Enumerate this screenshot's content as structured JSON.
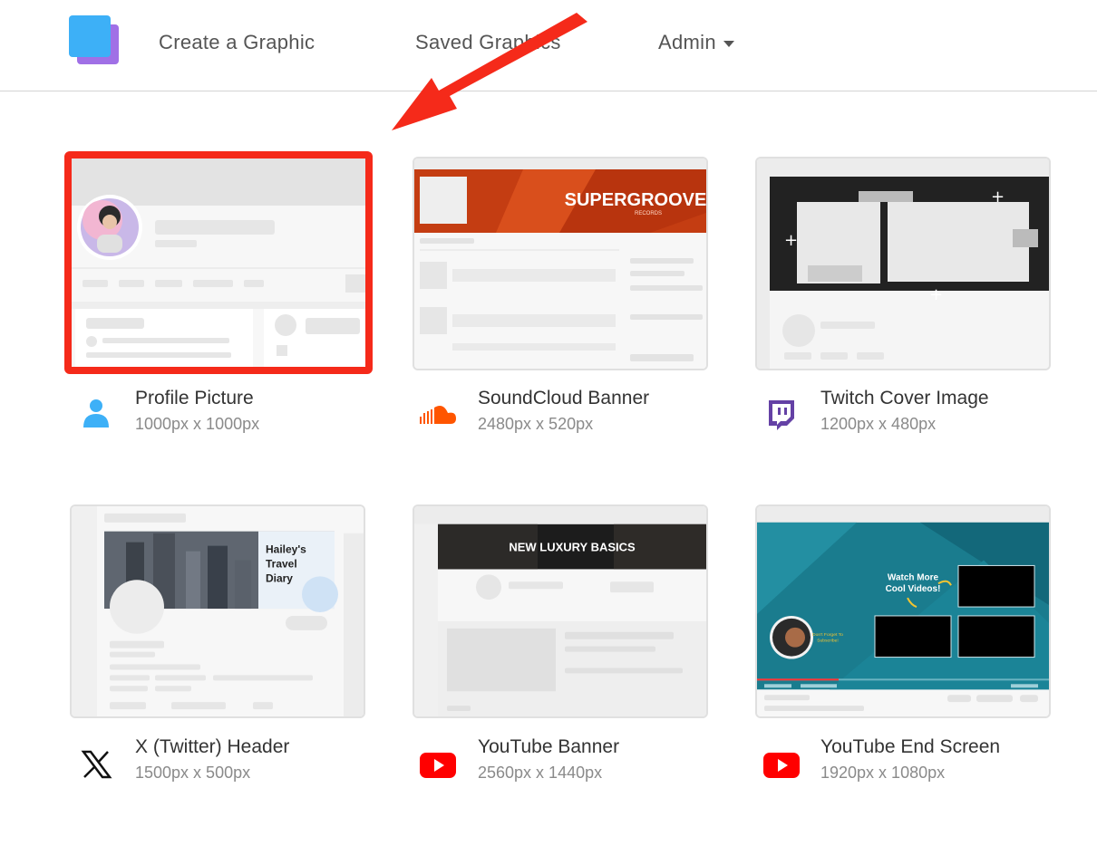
{
  "nav": {
    "create": "Create a Graphic",
    "saved": "Saved Graphics",
    "admin": "Admin"
  },
  "templates": [
    {
      "title": "Profile Picture",
      "dims": "1000px x 1000px",
      "icon": "user-icon",
      "selected": true
    },
    {
      "title": "SoundCloud Banner",
      "dims": "2480px x 520px",
      "icon": "soundcloud-icon"
    },
    {
      "title": "Twitch Cover Image",
      "dims": "1200px x 480px",
      "icon": "twitch-icon"
    },
    {
      "title": "X (Twitter) Header",
      "dims": "1500px x 500px",
      "icon": "x-icon"
    },
    {
      "title": "YouTube Banner",
      "dims": "2560px x 1440px",
      "icon": "youtube-icon"
    },
    {
      "title": "YouTube End Screen",
      "dims": "1920px x 1080px",
      "icon": "youtube-icon"
    }
  ],
  "previews": {
    "soundcloud_brand": "SUPERGROOVE",
    "soundcloud_sub": "RECORDS",
    "twitter_banner": [
      "Hailey's",
      "Travel",
      "Diary"
    ],
    "youtube_banner": "NEW LUXURY BASICS",
    "endscreen_cta": [
      "Watch More",
      "Cool Videos!"
    ],
    "endscreen_sub": [
      "Don't Forget To",
      "Subscribe!"
    ]
  },
  "colors": {
    "selection": "#f52a1a",
    "arrow": "#f52a1a",
    "logo_front": "#3db0f7",
    "logo_back": "#a070e6",
    "soundcloud": "#ff5500",
    "twitch": "#6441a5",
    "youtube": "#ff0000"
  }
}
